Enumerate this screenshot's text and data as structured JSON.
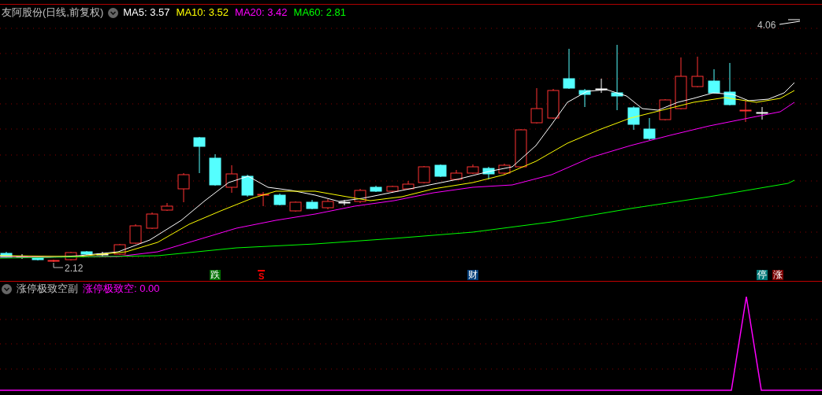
{
  "main_chart": {
    "title": "友阿股份(日线,前复权)",
    "moving_averages": [
      {
        "label": "MA5: 3.57",
        "color": "#ffffff"
      },
      {
        "label": "MA10: 3.52",
        "color": "#ffff00"
      },
      {
        "label": "MA20: 3.42",
        "color": "#ff00ff"
      },
      {
        "label": "MA60: 2.81",
        "color": "#00ff00"
      }
    ],
    "price_labels": [
      {
        "text": "4.06",
        "kind": "high"
      },
      {
        "text": "2.12",
        "kind": "low"
      }
    ],
    "markers": [
      {
        "text": "跌",
        "kind": "badge",
        "color": "#006f00"
      },
      {
        "text": "S",
        "kind": "signal",
        "color": "#ff0000"
      },
      {
        "text": "财",
        "kind": "badge",
        "color": "#003c78"
      },
      {
        "text": "停",
        "kind": "badge",
        "color": "#007878"
      },
      {
        "text": "涨",
        "kind": "badge",
        "color": "#7a0000"
      }
    ]
  },
  "indicator_panel": {
    "name": "涨停极致空副",
    "value_label": "涨停极致空: 0.00"
  }
}
